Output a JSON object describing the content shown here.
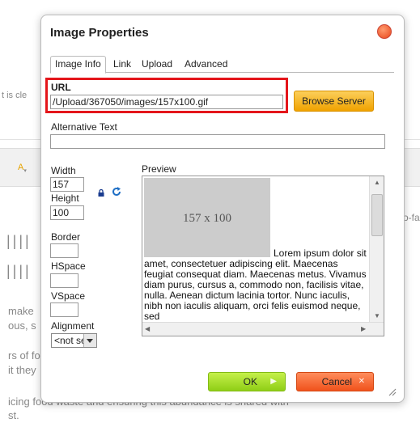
{
  "background": {
    "text1": "t is cle",
    "text_right": "o-fa",
    "pipes1": "||||",
    "pipes2": "||||",
    "make": "make",
    "ous": "ous, s",
    "rs_of": "rs of fo",
    "it_they": "it they",
    "icing": "icing food waste and ensuring this abundance is shared with",
    "st": "st."
  },
  "dialog": {
    "title": "Image Properties",
    "tabs": [
      "Image Info",
      "Link",
      "Upload",
      "Advanced"
    ],
    "active_tab": "Image Info",
    "url": {
      "label": "URL",
      "value": "/Upload/367050/images/157x100.gif"
    },
    "browse_button": "Browse Server",
    "alt_text": {
      "label": "Alternative Text",
      "value": ""
    },
    "width": {
      "label": "Width",
      "value": "157"
    },
    "height": {
      "label": "Height",
      "value": "100"
    },
    "border": {
      "label": "Border",
      "value": ""
    },
    "hspace": {
      "label": "HSpace",
      "value": ""
    },
    "vspace": {
      "label": "VSpace",
      "value": ""
    },
    "alignment": {
      "label": "Alignment",
      "selected": "<not set>"
    },
    "preview": {
      "label": "Preview",
      "image_text": "157 x 100",
      "text_first": "Lorem ipsum dolor sit",
      "text_rest": "amet, consectetuer adipiscing elit. Maecenas feugiat consequat diam. Maecenas metus. Vivamus diam purus, cursus a, commodo non, facilisis vitae, nulla. Aenean dictum lacinia tortor. Nunc iaculis, nibh non iaculis aliquam, orci felis euismod neque, sed"
    },
    "ok_button": "OK",
    "cancel_button": "Cancel"
  },
  "icons": {
    "close": "close-icon",
    "lock": "lock-icon",
    "reset": "reset-size-icon",
    "resize": "resize-grip-icon"
  },
  "colors": {
    "url_highlight": "#e4161b",
    "browse": "#f0a200",
    "ok": "#8fce16",
    "cancel": "#f0521c"
  }
}
